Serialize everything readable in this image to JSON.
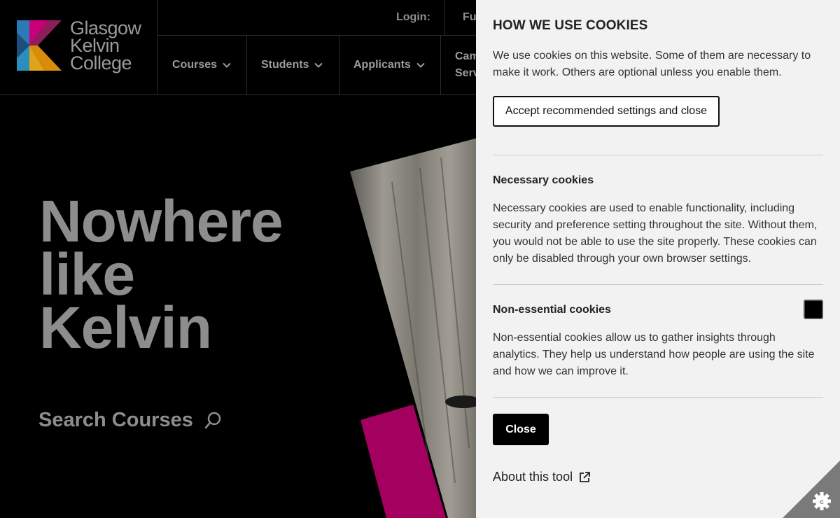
{
  "site": {
    "logo": {
      "lines": [
        "Glasgow",
        "Kelvin",
        "College"
      ]
    },
    "topbar": {
      "login_label": "Login:",
      "partial_link": "Fu"
    },
    "nav": [
      {
        "label": "Courses"
      },
      {
        "label": "Students"
      },
      {
        "label": "Applicants"
      },
      {
        "label_line1": "Cam",
        "label_line2": "Serv"
      }
    ],
    "hero": {
      "title_lines": [
        "Nowhere",
        "like",
        "Kelvin"
      ],
      "search_label": "Search Courses"
    }
  },
  "cookie_panel": {
    "title": "HOW WE USE COOKIES",
    "intro": "We use cookies on this website. Some of them are necessary to make it work. Others are optional unless you enable them.",
    "accept_label": "Accept recommended settings and close",
    "necessary": {
      "title": "Necessary cookies",
      "text": "Necessary cookies are used to enable functionality, including security and preference setting throughout the site. Without them, you would not be able to use the site properly. These cookies can only be disabled through your own browser settings."
    },
    "non_essential": {
      "title": "Non-essential cookies",
      "text": "Non-essential cookies allow us to gather insights through analytics. They help us understand how people are using the site and how we can improve it.",
      "enabled": false
    },
    "close_label": "Close",
    "about_label": "About this tool",
    "about_icon": "external-link-icon",
    "corner_icon": "cookie-settings-gear-icon"
  },
  "colors": {
    "panel_bg": "#f2f2f2",
    "brand_magenta": "#a3005f",
    "button_dark": "#000000"
  }
}
